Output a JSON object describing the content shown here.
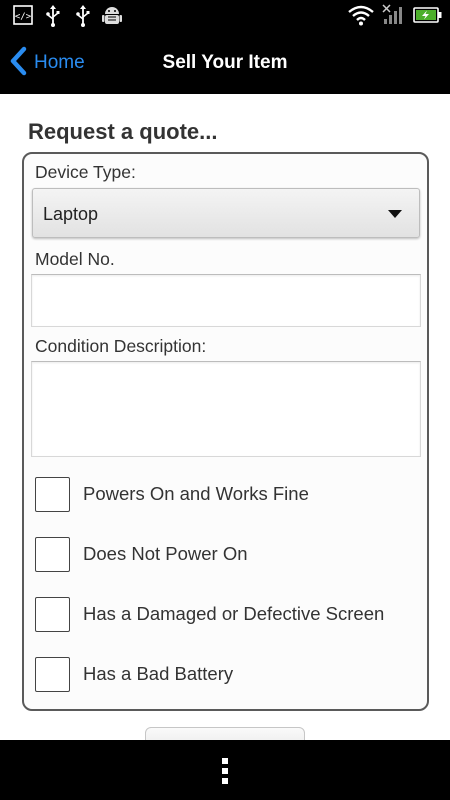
{
  "status_bar": {
    "left_icons": [
      "debug-icon",
      "usb-icon",
      "usb-icon",
      "android-debug-icon"
    ],
    "right_icons": [
      "wifi-icon",
      "signal-icon",
      "battery-charging-icon"
    ]
  },
  "nav": {
    "back_label": "Home",
    "title": "Sell Your Item",
    "accent_color": "#2a8cf0"
  },
  "form": {
    "heading": "Request a quote...",
    "device_type": {
      "label": "Device Type:",
      "selected": "Laptop"
    },
    "model": {
      "label": "Model No.",
      "value": ""
    },
    "condition": {
      "label": "Condition Description:",
      "value": ""
    },
    "checkboxes": [
      {
        "label": "Powers On and Works Fine",
        "checked": false
      },
      {
        "label": "Does Not Power On",
        "checked": false
      },
      {
        "label": "Has a Damaged or Defective Screen",
        "checked": false
      },
      {
        "label": "Has a Bad Battery",
        "checked": false
      }
    ]
  },
  "bottom_bar": {
    "menu_icon": "overflow-menu-icon"
  }
}
